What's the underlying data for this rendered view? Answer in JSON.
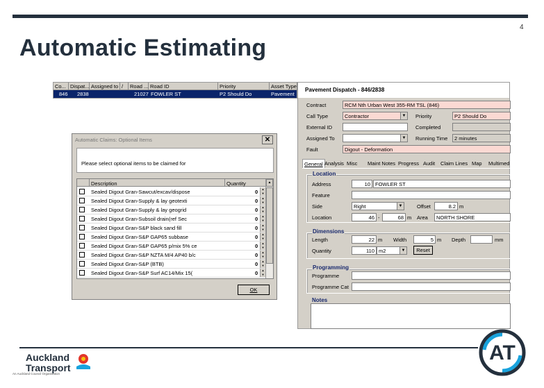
{
  "page": {
    "number": "4",
    "title": "Automatic Estimating"
  },
  "grid": {
    "headers": [
      "Co...",
      "Dispat...",
      "Assigned to",
      "/",
      "Road ...",
      "Road ID",
      "Priority",
      "Asset Type"
    ],
    "row": [
      "846",
      "2838",
      "",
      "",
      "21027",
      "FOWLER ST",
      "P2 Should Do",
      "Pavement"
    ]
  },
  "panel": {
    "title": "Pavement Dispatch - 846/2838",
    "contract_label": "Contract",
    "contract_value": "RCM Nth Urban West 355-RM TSL (846)",
    "calltype_label": "Call Type",
    "calltype_value": "Contractor",
    "priority_label": "Priority",
    "priority_value": "P2 Should Do",
    "external_label": "External ID",
    "completed_label": "Completed",
    "assigned_label": "Assigned To",
    "running_label": "Running Time",
    "running_value": "2 minutes",
    "fault_label": "Fault",
    "fault_value": "Digout - Deformation",
    "tabs": [
      "General",
      "Analysis",
      "Misc",
      "Maint Notes",
      "Progress",
      "Audit",
      "Claim Lines",
      "Map",
      "Multimed"
    ],
    "location": {
      "section": "Location",
      "address_label": "Address",
      "address_num": "10",
      "address_street": "FOWLER ST",
      "feature_label": "Feature",
      "side_label": "Side",
      "side_value": "Right",
      "offset_label": "Offset",
      "offset_value": "8.2",
      "offset_unit": "m",
      "loc_label": "Location",
      "loc_from": "46",
      "loc_dash": "-",
      "loc_to": "68",
      "loc_unit": "m",
      "area_label": "Area",
      "area_value": "NORTH SHORE"
    },
    "dimensions": {
      "section": "Dimensions",
      "length_label": "Length",
      "length_value": "22",
      "length_unit": "m",
      "width_label": "Width",
      "width_value": "5",
      "width_unit": "m",
      "depth_label": "Depth",
      "depth_unit": "mm",
      "qty_label": "Quantity",
      "qty_value": "110",
      "qty_unit": "m2",
      "reset_label": "Reset"
    },
    "programming": {
      "section": "Programming",
      "prog_label": "Programme",
      "progcat_label": "Programme Cat"
    },
    "notes": {
      "section": "Notes"
    }
  },
  "dialog": {
    "title": "Automatic Claims: Optional Items",
    "close": "✕",
    "message": "Please select optional items to be claimed for",
    "col_desc": "Description",
    "col_qty": "Quantity",
    "items": [
      {
        "desc": "Sealed Digout Gran-Sawcut/excav/dispose",
        "qty": "0"
      },
      {
        "desc": "Sealed Digout Gran-Supply & lay geotexti",
        "qty": "0"
      },
      {
        "desc": "Sealed Digout Gran-Supply & lay geogrid",
        "qty": "0"
      },
      {
        "desc": "Sealed Digout Gran-Subsoil drain(ref Sec",
        "qty": "0"
      },
      {
        "desc": "Sealed Digout Gran-S&P black sand fill",
        "qty": "0"
      },
      {
        "desc": "Sealed Digout Gran-S&P GAP65 subbase",
        "qty": "0"
      },
      {
        "desc": "Sealed Digout Gran-S&P GAP65 p/mix 5% ce",
        "qty": "0"
      },
      {
        "desc": "Sealed Digout Gran-S&P NZTA M/4 AP40 b/c",
        "qty": "0"
      },
      {
        "desc": "Sealed Digout Gran-S&P (BTB)",
        "qty": "0"
      },
      {
        "desc": "Sealed Digout Gran-S&P Surf AC14/Mix 15(",
        "qty": "0"
      }
    ],
    "ok_label": "OK"
  },
  "brand": {
    "line1": "Auckland",
    "line2": "Transport",
    "tagline": "An Auckland Council Organisation",
    "logo_text": "AT"
  },
  "colors": {
    "navy": "#24303d",
    "select": "#0a246a",
    "pink": "#fbd9d3"
  }
}
